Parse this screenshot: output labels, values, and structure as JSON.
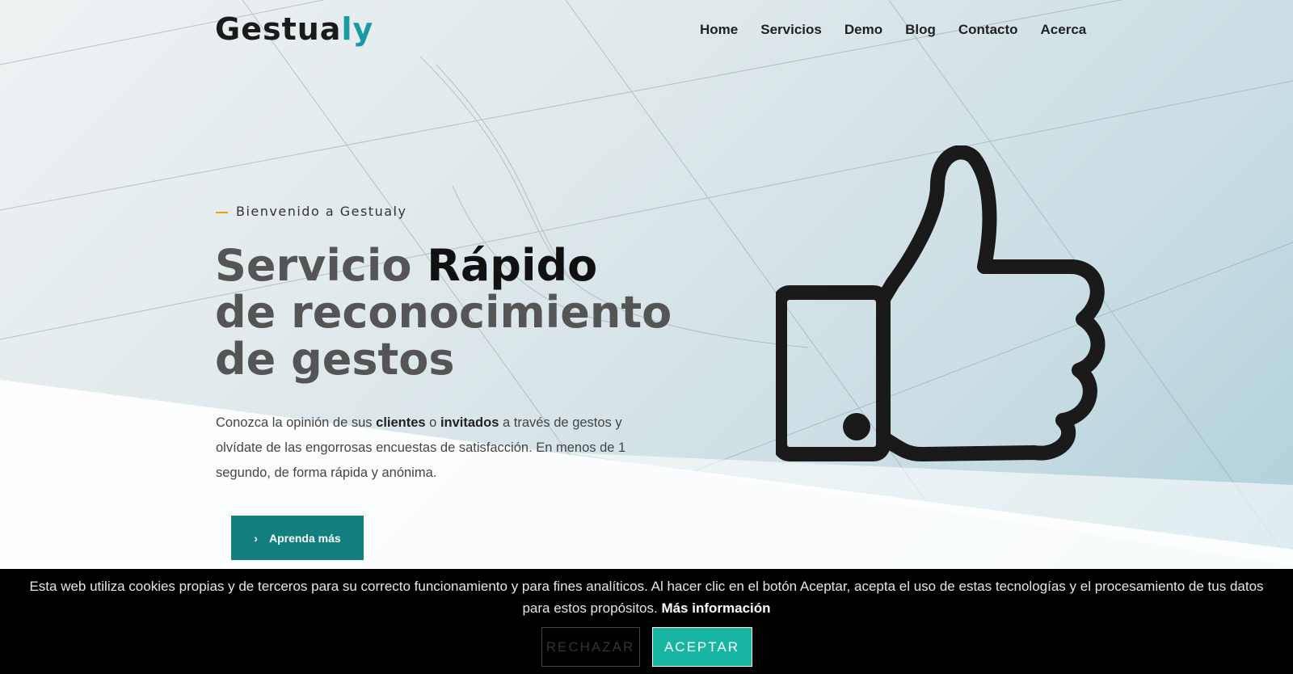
{
  "header": {
    "logo_main": "Gestua",
    "logo_accent": "ly",
    "nav": [
      "Home",
      "Servicios",
      "Demo",
      "Blog",
      "Contacto",
      "Acerca"
    ]
  },
  "hero": {
    "kicker": "Bienvenido a Gestualy",
    "title_light": "Servicio ",
    "title_bold": "Rápido",
    "title_rest": "de reconocimiento de gestos",
    "desc_1": "Conozca la opinión de sus ",
    "desc_b1": "clientes",
    "desc_2": " o ",
    "desc_b2": "invitados",
    "desc_3": " a través de gestos y olvídate de las engorrosas encuestas de satisfacción. En menos de 1 segundo, de forma rápida y anónima.",
    "button": "Aprenda más"
  },
  "cookie": {
    "text": "Esta web utiliza cookies propias y de terceros para su correcto funcionamiento y para fines analíticos. Al hacer clic en el botón Aceptar, acepta el uso de estas tecnologías y el procesamiento de tus datos para estos propósitos. ",
    "link": "Más información",
    "reject": "RECHAZAR",
    "accept": "ACEPTAR"
  }
}
